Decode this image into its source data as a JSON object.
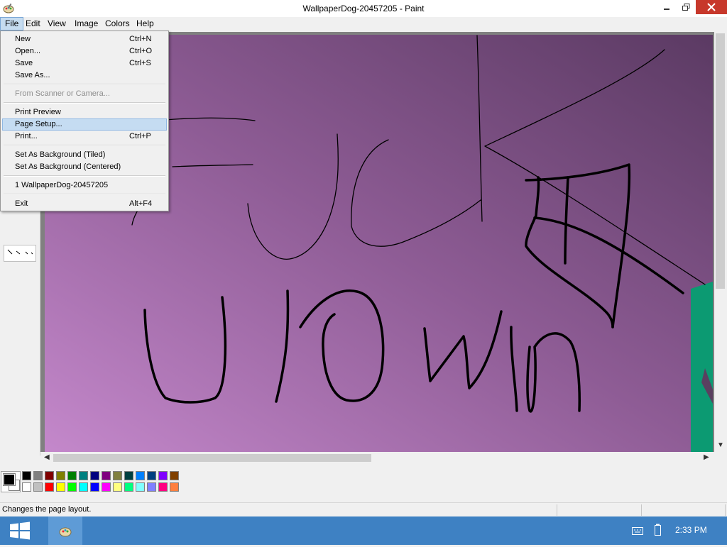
{
  "window": {
    "title": "WallpaperDog-20457205 - Paint"
  },
  "menubar": {
    "items": [
      {
        "label": "File"
      },
      {
        "label": "Edit"
      },
      {
        "label": "View"
      },
      {
        "label": "Image"
      },
      {
        "label": "Colors"
      },
      {
        "label": "Help"
      }
    ]
  },
  "file_menu": {
    "items": [
      {
        "label": "New",
        "shortcut": "Ctrl+N"
      },
      {
        "label": "Open...",
        "shortcut": "Ctrl+O"
      },
      {
        "label": "Save",
        "shortcut": "Ctrl+S"
      },
      {
        "label": "Save As...",
        "shortcut": ""
      },
      {
        "label": "From Scanner or Camera...",
        "shortcut": "",
        "disabled": true
      },
      {
        "label": "Print Preview",
        "shortcut": ""
      },
      {
        "label": "Page Setup...",
        "shortcut": "",
        "highlighted": true
      },
      {
        "label": "Print...",
        "shortcut": "Ctrl+P"
      },
      {
        "label": "Set As Background (Tiled)",
        "shortcut": ""
      },
      {
        "label": "Set As Background (Centered)",
        "shortcut": ""
      },
      {
        "label": "1 WallpaperDog-20457205",
        "shortcut": ""
      },
      {
        "label": "Exit",
        "shortcut": "Alt+F4"
      }
    ]
  },
  "palette": {
    "foreground": "#000000",
    "background": "#ffffff",
    "row1": [
      "#000000",
      "#808080",
      "#800000",
      "#808000",
      "#008000",
      "#008080",
      "#000080",
      "#800080",
      "#808040",
      "#004040",
      "#0080ff",
      "#004080",
      "#8000ff",
      "#804000"
    ],
    "row2": [
      "#ffffff",
      "#c0c0c0",
      "#ff0000",
      "#ffff00",
      "#00ff00",
      "#00ffff",
      "#0000ff",
      "#ff00ff",
      "#ffff80",
      "#00ff80",
      "#80ffff",
      "#8080ff",
      "#ff0080",
      "#ff8040"
    ]
  },
  "status": {
    "text": "Changes the page layout."
  },
  "taskbar": {
    "time": "2:33 PM"
  }
}
